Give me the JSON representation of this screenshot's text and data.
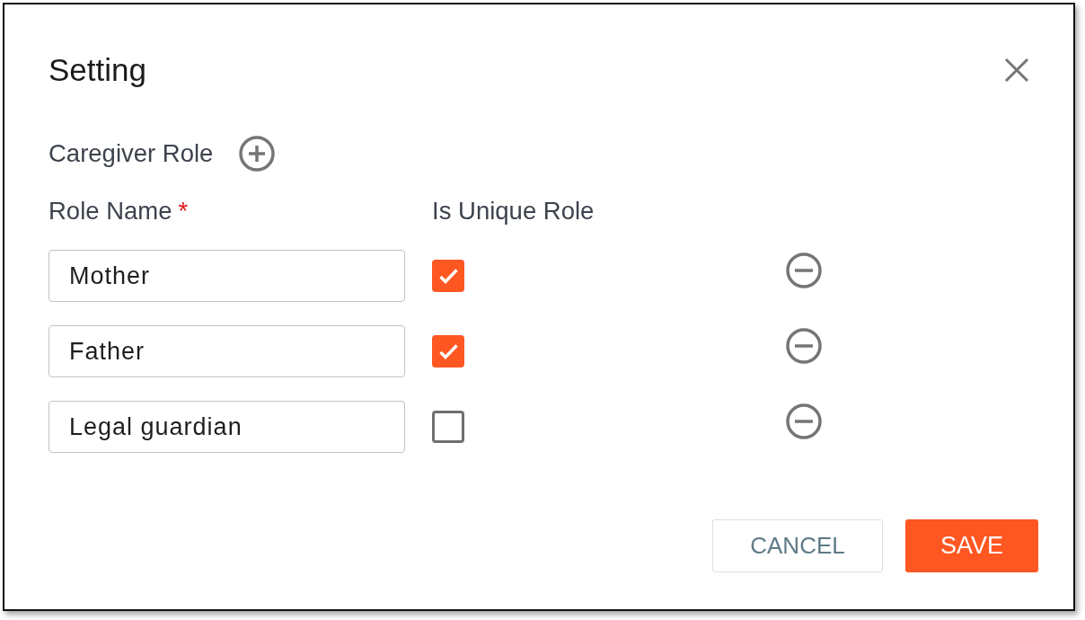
{
  "dialog": {
    "title": "Setting",
    "section": {
      "label": "Caregiver Role"
    },
    "columns": [
      {
        "label": "Role Name",
        "required_mark": "*"
      },
      {
        "label": "Is Unique Role"
      }
    ],
    "roles": [
      {
        "name": "Mother",
        "unique": true
      },
      {
        "name": "Father",
        "unique": true
      },
      {
        "name": "Legal guardian",
        "unique": false
      }
    ],
    "buttons": [
      {
        "label": "CANCEL",
        "kind": "secondary"
      },
      {
        "label": "SAVE",
        "kind": "primary"
      }
    ]
  }
}
